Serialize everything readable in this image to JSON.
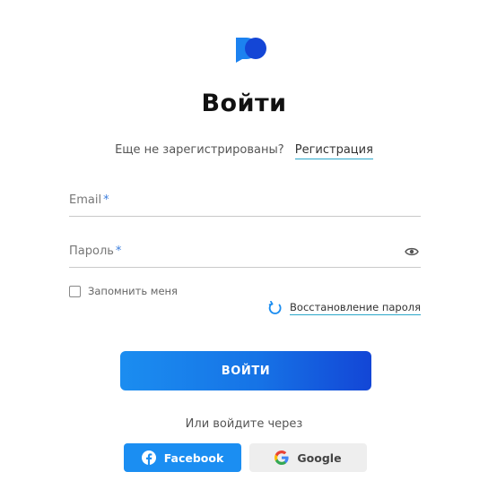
{
  "brand": {
    "logo_color_light": "#1c82f0",
    "logo_color_dark": "#1446d6"
  },
  "title": "Войти",
  "register": {
    "prompt": "Еще не зарегистрированы?",
    "link": "Регистрация"
  },
  "form": {
    "email": {
      "label": "Email",
      "required_mark": "*",
      "value": ""
    },
    "password": {
      "label": "Пароль",
      "required_mark": "*",
      "value": "",
      "toggle_icon": "eye-icon"
    },
    "remember": {
      "label": "Запомнить меня",
      "checked": false
    },
    "restore": {
      "label": "Восстановление пароля",
      "icon": "refresh-icon"
    },
    "submit_label": "ВОЙТИ"
  },
  "alt_login": {
    "prompt": "Или войдите через",
    "facebook_label": "Facebook",
    "google_label": "Google"
  },
  "colors": {
    "accent": "#1b8df0",
    "accent_dark": "#1346d6",
    "link_underline": "#2aa7c9",
    "facebook": "#1b8ef2",
    "google_bg": "#eeeeee"
  }
}
